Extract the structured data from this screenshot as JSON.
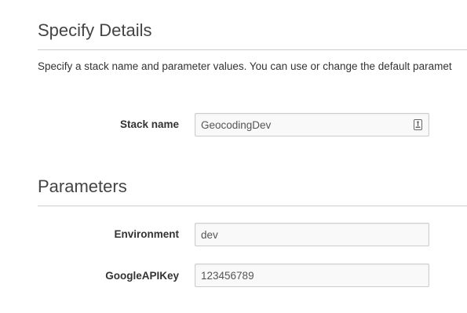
{
  "details": {
    "title": "Specify Details",
    "description": "Specify a stack name and parameter values. You can use or change the default paramet"
  },
  "stack_name": {
    "label": "Stack name",
    "value": "GeocodingDev",
    "icon": "keychain-autofill-icon"
  },
  "parameters": {
    "title": "Parameters",
    "fields": [
      {
        "label": "Environment",
        "value": "dev"
      },
      {
        "label": "GoogleAPIKey",
        "value": "123456789"
      }
    ]
  }
}
